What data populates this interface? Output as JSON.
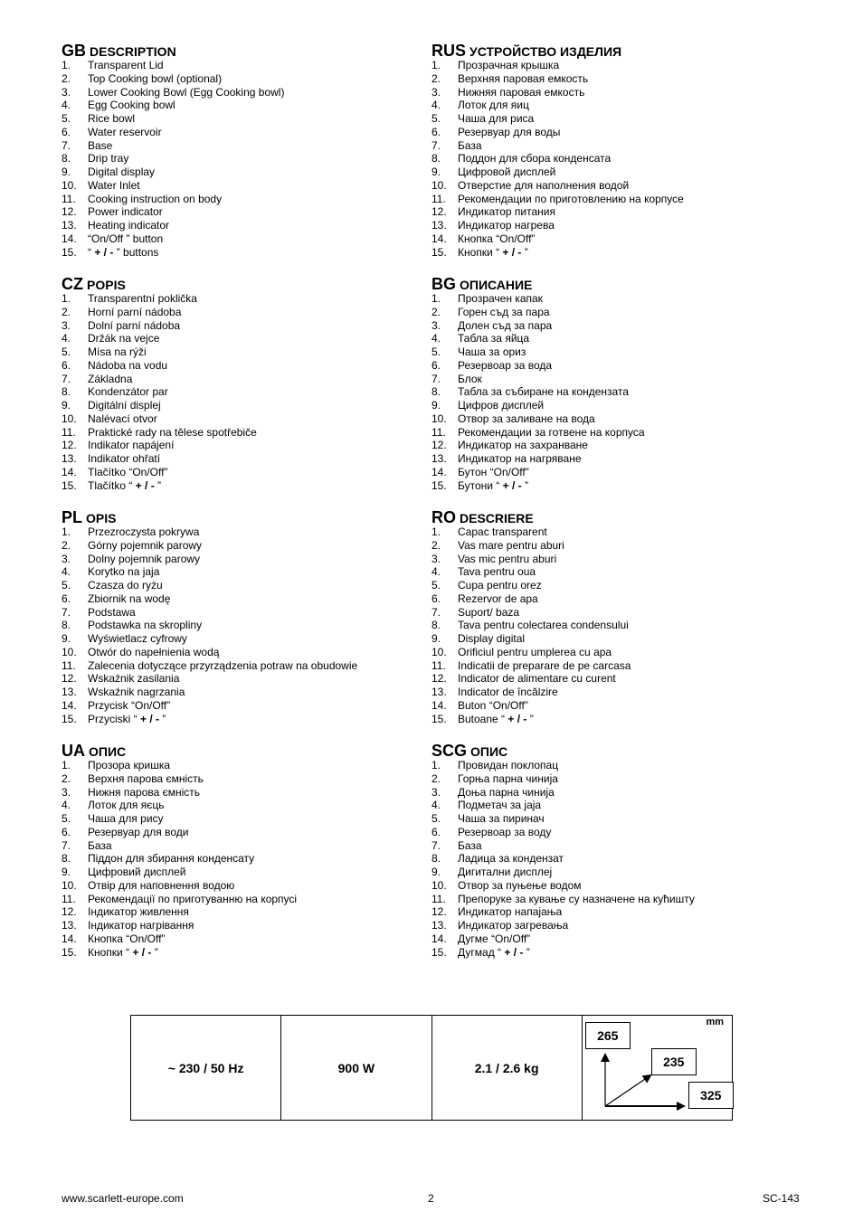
{
  "sections": [
    {
      "code": "GB",
      "title": "DESCRIPTION",
      "items": [
        {
          "n": "1.",
          "t": "Transparent Lid"
        },
        {
          "n": "2.",
          "t": "Top Cooking bowl (optional)"
        },
        {
          "n": "3.",
          "t": "Lower Cooking Bowl (Egg Cooking bowl)"
        },
        {
          "n": "4.",
          "t": "Egg Cooking bowl"
        },
        {
          "n": "5.",
          "t": "Rice bowl"
        },
        {
          "n": "6.",
          "t": "Water reservoir"
        },
        {
          "n": "7.",
          "t": "Base"
        },
        {
          "n": "8.",
          "t": "Drip tray"
        },
        {
          "n": "9.",
          "t": "Digital display"
        },
        {
          "n": "10.",
          "t": "Water Inlet"
        },
        {
          "n": "11.",
          "t": "Cooking instruction on body"
        },
        {
          "n": "12.",
          "t": "Power indicator"
        },
        {
          "n": "13.",
          "t": "Heating indicator"
        },
        {
          "n": "14.",
          "t": "“On/Off ” button"
        },
        {
          "n": "15.",
          "pre": "“ ",
          "b": "+ / -",
          "post": " ” buttons"
        }
      ]
    },
    {
      "code": "RUS",
      "title": "УСТРОЙСТВО ИЗДЕЛИЯ",
      "items": [
        {
          "n": "1.",
          "t": "Прозрачная крышка"
        },
        {
          "n": "2.",
          "t": "Верхняя паровая емкость"
        },
        {
          "n": "3.",
          "t": "Нижняя паровая емкость"
        },
        {
          "n": "4.",
          "t": "Лоток для яиц"
        },
        {
          "n": "5.",
          "t": "Чаша для риса"
        },
        {
          "n": "6.",
          "t": "Резервуар для воды"
        },
        {
          "n": "7.",
          "t": "База"
        },
        {
          "n": "8.",
          "t": "Поддон для сбора конденсата"
        },
        {
          "n": "9.",
          "t": "Цифровой дисплей"
        },
        {
          "n": "10.",
          "t": "Отверстие для наполнения водой"
        },
        {
          "n": "11.",
          "t": "Рекомендации по приготовлению на корпусе"
        },
        {
          "n": "12.",
          "t": "Индикатор питания"
        },
        {
          "n": "13.",
          "t": "Индикатор нагрева"
        },
        {
          "n": "14.",
          "t": "Кнопка “On/Off”"
        },
        {
          "n": "15.",
          "pre": "Кнопки “ ",
          "b": "+ / -",
          "post": " ”"
        }
      ]
    },
    {
      "code": "CZ",
      "title": "POPIS",
      "items": [
        {
          "n": "1.",
          "t": "Transparentní poklička"
        },
        {
          "n": "2.",
          "t": "Horní parní nádoba"
        },
        {
          "n": "3.",
          "t": "Dolní parní nádoba"
        },
        {
          "n": "4.",
          "t": "Držák na vejce"
        },
        {
          "n": "5.",
          "t": "Mísa na rýži"
        },
        {
          "n": "6.",
          "t": "Nádoba na vodu"
        },
        {
          "n": "7.",
          "t": "Základna"
        },
        {
          "n": "8.",
          "t": "Kondenzátor par"
        },
        {
          "n": "9.",
          "t": "Digitální displej"
        },
        {
          "n": "10.",
          "t": "Nalévací otvor"
        },
        {
          "n": "11.",
          "t": "Praktické rady na tělese spotřebiče"
        },
        {
          "n": "12.",
          "t": "Indikator napájení"
        },
        {
          "n": "13.",
          "t": "Indikator ohřatí"
        },
        {
          "n": "14.",
          "t": "Tlačítko “On/Off”"
        },
        {
          "n": "15.",
          "pre": "Tlačítko “ ",
          "b": "+ / -",
          "post": " ”"
        }
      ]
    },
    {
      "code": "BG",
      "title": "ОПИСАНИЕ",
      "items": [
        {
          "n": "1.",
          "t": "Прозрачен капак"
        },
        {
          "n": "2.",
          "t": "Горен съд за пара"
        },
        {
          "n": "3.",
          "t": "Долен съд за пара"
        },
        {
          "n": "4.",
          "t": "Табла за яйца"
        },
        {
          "n": "5.",
          "t": "Чаша за ориз"
        },
        {
          "n": "6.",
          "t": "Резервоар за вода"
        },
        {
          "n": "7.",
          "t": "Блок"
        },
        {
          "n": "8.",
          "t": "Табла за събиране на кондензата"
        },
        {
          "n": "9.",
          "t": "Цифров дисплей"
        },
        {
          "n": "10.",
          "t": "Отвор за заливане на вода"
        },
        {
          "n": "11.",
          "t": "Рекомендации за готвене на корпуса"
        },
        {
          "n": "12.",
          "t": "Индикатор на захранване"
        },
        {
          "n": "13.",
          "t": "Индикатор на нагряване"
        },
        {
          "n": "14.",
          "t": "Бутон “On/Off”"
        },
        {
          "n": "15.",
          "pre": "Бутони “ ",
          "b": "+ / -",
          "post": " ”"
        }
      ]
    },
    {
      "code": "PL",
      "title": "OPIS",
      "items": [
        {
          "n": "1.",
          "t": "Przezroczysta pokrywa"
        },
        {
          "n": "2.",
          "t": "Górny pojemnik parowy"
        },
        {
          "n": "3.",
          "t": "Dolny pojemnik parowy"
        },
        {
          "n": "4.",
          "t": "Korytko na jaja"
        },
        {
          "n": "5.",
          "t": "Czasza do ryżu"
        },
        {
          "n": "6.",
          "t": "Zbiornik na wodę"
        },
        {
          "n": "7.",
          "t": "Podstawa"
        },
        {
          "n": "8.",
          "t": "Podstawka na skropliny"
        },
        {
          "n": "9.",
          "t": "Wyświetlacz cyfrowy"
        },
        {
          "n": "10.",
          "t": "Otwór do napełnienia wodą"
        },
        {
          "n": "11.",
          "t": "Zalecenia dotyczące przyrządzenia potraw na obudowie"
        },
        {
          "n": "12.",
          "t": "Wskaźnik zasilania"
        },
        {
          "n": "13.",
          "t": "Wskaźnik nagrzania"
        },
        {
          "n": "14.",
          "t": "Przycisk “On/Off”"
        },
        {
          "n": "15.",
          "pre": "Przyciski “ ",
          "b": "+ / -",
          "post": " ”"
        }
      ]
    },
    {
      "code": "RO",
      "title": "DESCRIERE",
      "items": [
        {
          "n": "1.",
          "t": "Capac transparent"
        },
        {
          "n": "2.",
          "t": "Vas mare pentru aburi"
        },
        {
          "n": "3.",
          "t": "Vas mic pentru aburi"
        },
        {
          "n": "4.",
          "t": "Tava pentru oua"
        },
        {
          "n": "5.",
          "t": "Cupa pentru orez"
        },
        {
          "n": "6.",
          "t": "Rezervor de apa"
        },
        {
          "n": "7.",
          "t": "Suport/ baza"
        },
        {
          "n": "8.",
          "t": "Tava pentru colectarea condensului"
        },
        {
          "n": "9.",
          "t": "Display digital"
        },
        {
          "n": "10.",
          "t": "Orificiul pentru umplerea cu apa"
        },
        {
          "n": "11.",
          "t": "Indicatii de preparare de pe carcasa"
        },
        {
          "n": "12.",
          "t": "Indicator de alimentare cu curent"
        },
        {
          "n": "13.",
          "t": "Indicator de încălzire"
        },
        {
          "n": "14.",
          "t": "Buton “On/Off”"
        },
        {
          "n": "15.",
          "pre": "Butoane “ ",
          "b": "+ / -",
          "post": " ”"
        }
      ]
    },
    {
      "code": "UA",
      "title": "ОПИС",
      "items": [
        {
          "n": "1.",
          "t": "Прозора кришка"
        },
        {
          "n": "2.",
          "t": "Верхня парова ємність"
        },
        {
          "n": "3.",
          "t": "Нижня парова ємність"
        },
        {
          "n": "4.",
          "t": "Лоток для яєць"
        },
        {
          "n": "5.",
          "t": "Чаша для рису"
        },
        {
          "n": "6.",
          "t": "Резервуар для води"
        },
        {
          "n": "7.",
          "t": "База"
        },
        {
          "n": "8.",
          "t": "Піддон для збирання конденсату"
        },
        {
          "n": "9.",
          "t": "Цифровий дисплей"
        },
        {
          "n": "10.",
          "t": "Отвір для наповнення водою"
        },
        {
          "n": "11.",
          "t": "Рекомендації по приготуванню на корпусі"
        },
        {
          "n": "12.",
          "t": "Індикатор живлення"
        },
        {
          "n": "13.",
          "t": "Індикатор нагрівання"
        },
        {
          "n": "14.",
          "t": "Кнопка “On/Off”"
        },
        {
          "n": "15.",
          "pre": "Кнопки “ ",
          "b": "+ / -",
          "post": " ”"
        }
      ]
    },
    {
      "code": "SCG",
      "title": "ОПИС",
      "items": [
        {
          "n": "1.",
          "t": "Провидан поклопац"
        },
        {
          "n": "2.",
          "t": "Горња парна чинија"
        },
        {
          "n": "3.",
          "t": "Доња парна чинија"
        },
        {
          "n": "4.",
          "t": "Подметач за јаја"
        },
        {
          "n": "5.",
          "t": "Чаша за пиринач"
        },
        {
          "n": "6.",
          "t": "Резервоар за воду"
        },
        {
          "n": "7.",
          "t": "База"
        },
        {
          "n": "8.",
          "t": "Ладица за кондензат"
        },
        {
          "n": "9.",
          "t": "Дигитални дисплеј"
        },
        {
          "n": "10.",
          "t": "Отвор за пуњење водом"
        },
        {
          "n": "11.",
          "t": "Препоруке за кување су назначене на кућишту"
        },
        {
          "n": "12.",
          "t": "Индикатор напајања"
        },
        {
          "n": "13.",
          "t": "Индикатор загревања"
        },
        {
          "n": "14.",
          "t": "Дугме “On/Off”"
        },
        {
          "n": "15.",
          "pre": "Дугмад “ ",
          "b": "+ / -",
          "post": " ”"
        }
      ]
    }
  ],
  "specs": {
    "voltage": "~ 230 / 50 Hz",
    "power": "900 W",
    "weight": "2.1 / 2.6 kg",
    "dimensions": {
      "unit": "mm",
      "height": "265",
      "depth": "235",
      "width": "325"
    }
  },
  "footer": {
    "website": "www.scarlett-europe.com",
    "page": "2",
    "model": "SC-143"
  }
}
